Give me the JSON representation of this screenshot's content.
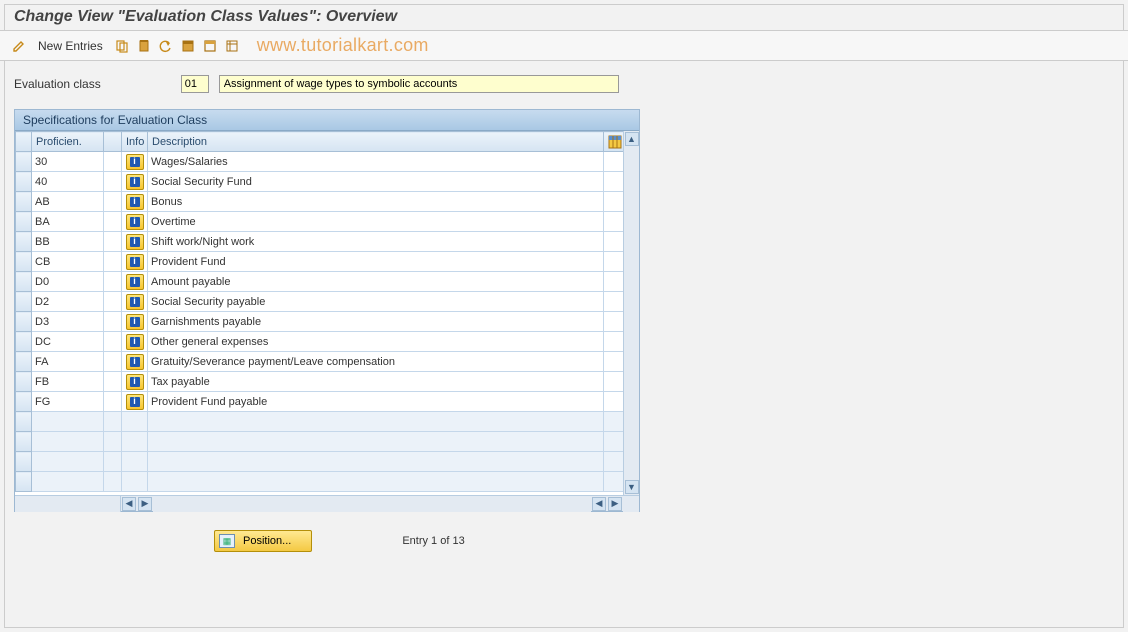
{
  "title": "Change View \"Evaluation Class Values\": Overview",
  "toolbar": {
    "new_entries": "New Entries"
  },
  "watermark": "www.tutorialkart.com",
  "filter": {
    "label": "Evaluation class",
    "code": "01",
    "desc": "Assignment of wage types to symbolic accounts"
  },
  "panel": {
    "header": "Specifications for Evaluation Class",
    "columns": {
      "prof": "Proficien.",
      "info": "Info",
      "desc": "Description"
    }
  },
  "rows": [
    {
      "prof": "30",
      "desc": "Wages/Salaries"
    },
    {
      "prof": "40",
      "desc": "Social Security Fund"
    },
    {
      "prof": "AB",
      "desc": "Bonus"
    },
    {
      "prof": "BA",
      "desc": "Overtime"
    },
    {
      "prof": "BB",
      "desc": "Shift work/Night work"
    },
    {
      "prof": "CB",
      "desc": "Provident Fund"
    },
    {
      "prof": "D0",
      "desc": "Amount payable"
    },
    {
      "prof": "D2",
      "desc": "Social Security payable"
    },
    {
      "prof": "D3",
      "desc": "Garnishments payable"
    },
    {
      "prof": "DC",
      "desc": "Other general expenses"
    },
    {
      "prof": "FA",
      "desc": "Gratuity/Severance payment/Leave compensation"
    },
    {
      "prof": "FB",
      "desc": "Tax payable"
    },
    {
      "prof": "FG",
      "desc": "Provident Fund payable"
    }
  ],
  "empty_rows": 4,
  "footer": {
    "position_label": "Position...",
    "entry_text": "Entry 1 of 13"
  }
}
